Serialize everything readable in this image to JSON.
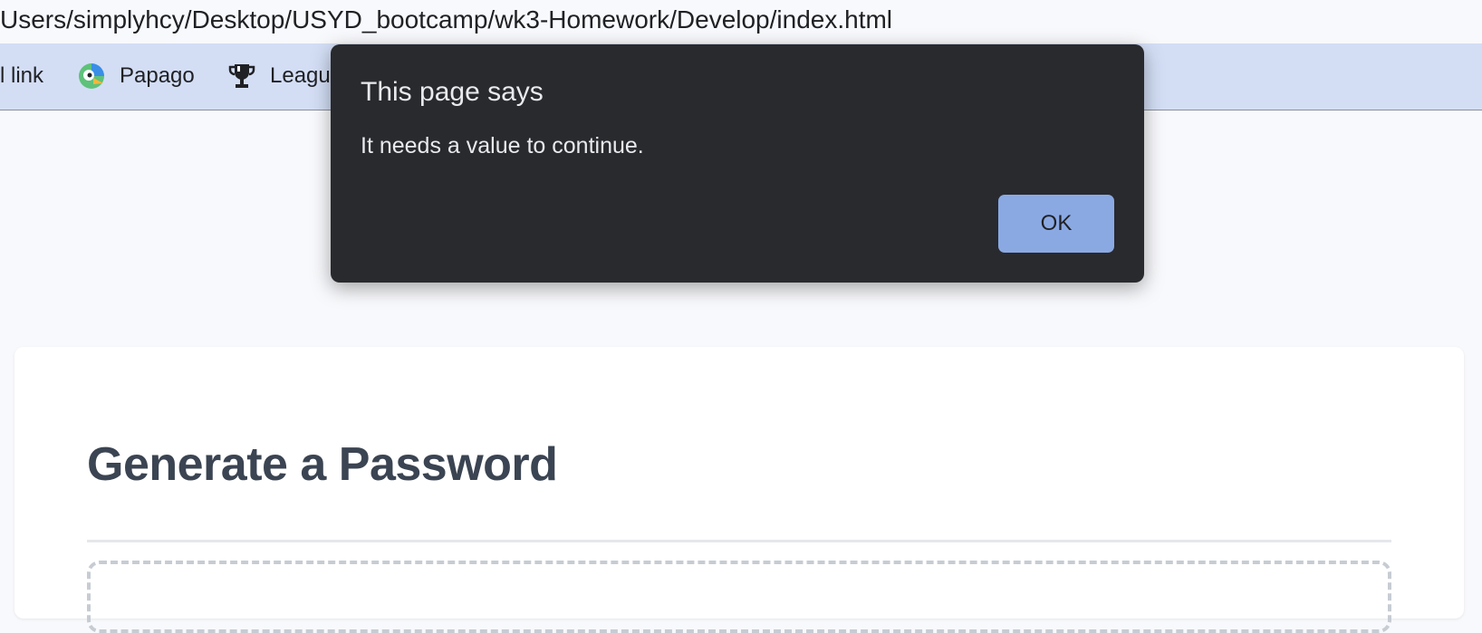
{
  "browser": {
    "url": "Users/simplyhcy/Desktop/USYD_bootcamp/wk3-Homework/Develop/index.html",
    "bookmarks": [
      {
        "label": "l link",
        "icon": "link-icon"
      },
      {
        "label": "Papago",
        "icon": "papago-icon"
      },
      {
        "label": "Leagu",
        "icon": "trophy-icon"
      }
    ]
  },
  "dialog": {
    "title": "This page says",
    "message": "It needs a value to continue.",
    "ok_label": "OK"
  },
  "page": {
    "heading": "Generate a Password"
  },
  "colors": {
    "dialog_bg": "#292a2d",
    "ok_button": "#8aa9e3",
    "bookmarks_bar": "#d3def5",
    "heading": "#3b4452"
  }
}
